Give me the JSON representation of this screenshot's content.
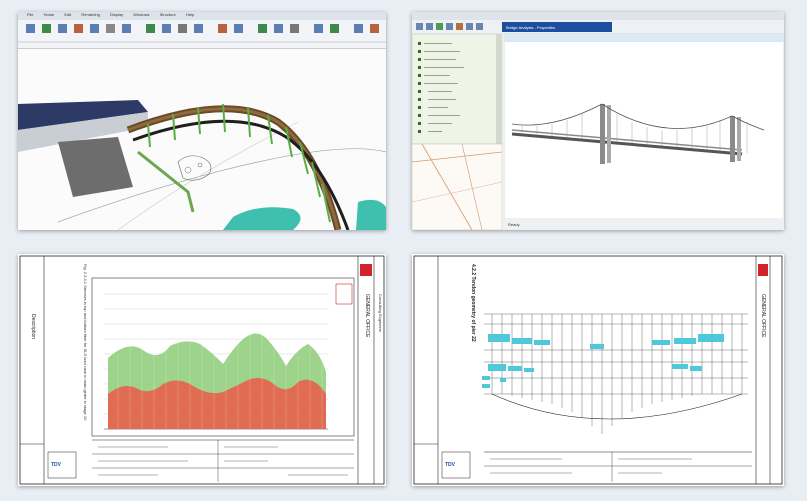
{
  "panels": [
    {
      "id": "bridge-3d-modeling-window",
      "ribbon_tabs": [
        "File",
        "Home",
        "Edit",
        "Rendering",
        "Display",
        "Windows",
        "Structure",
        "Help"
      ]
    },
    {
      "id": "bridge-analysis-window",
      "title_text": "Bridge Analysis - Properties",
      "status_text": "Ready"
    },
    {
      "id": "chart-report-sheet",
      "header_note": "Fig. 2.3.4.1 Stresses in top and bottom fiber for SLS load case in main girder in stage 10"
    },
    {
      "id": "tendon-geometry-sheet",
      "header_title": "4.2.2 Tendon geometry of pier 22"
    }
  ],
  "sheet_labels": {
    "company_line1": "GENERAL OFFICE",
    "company_line2": "Consulting Engineers",
    "logo": "TDV",
    "left_strip": "Description"
  },
  "colors": {
    "green_bars": "#7fc06a",
    "red_bars": "#e5553f",
    "cyan_markers": "#4fc9d9",
    "panel_bg": "#ffffff",
    "page_bg": "#e8eef3"
  }
}
